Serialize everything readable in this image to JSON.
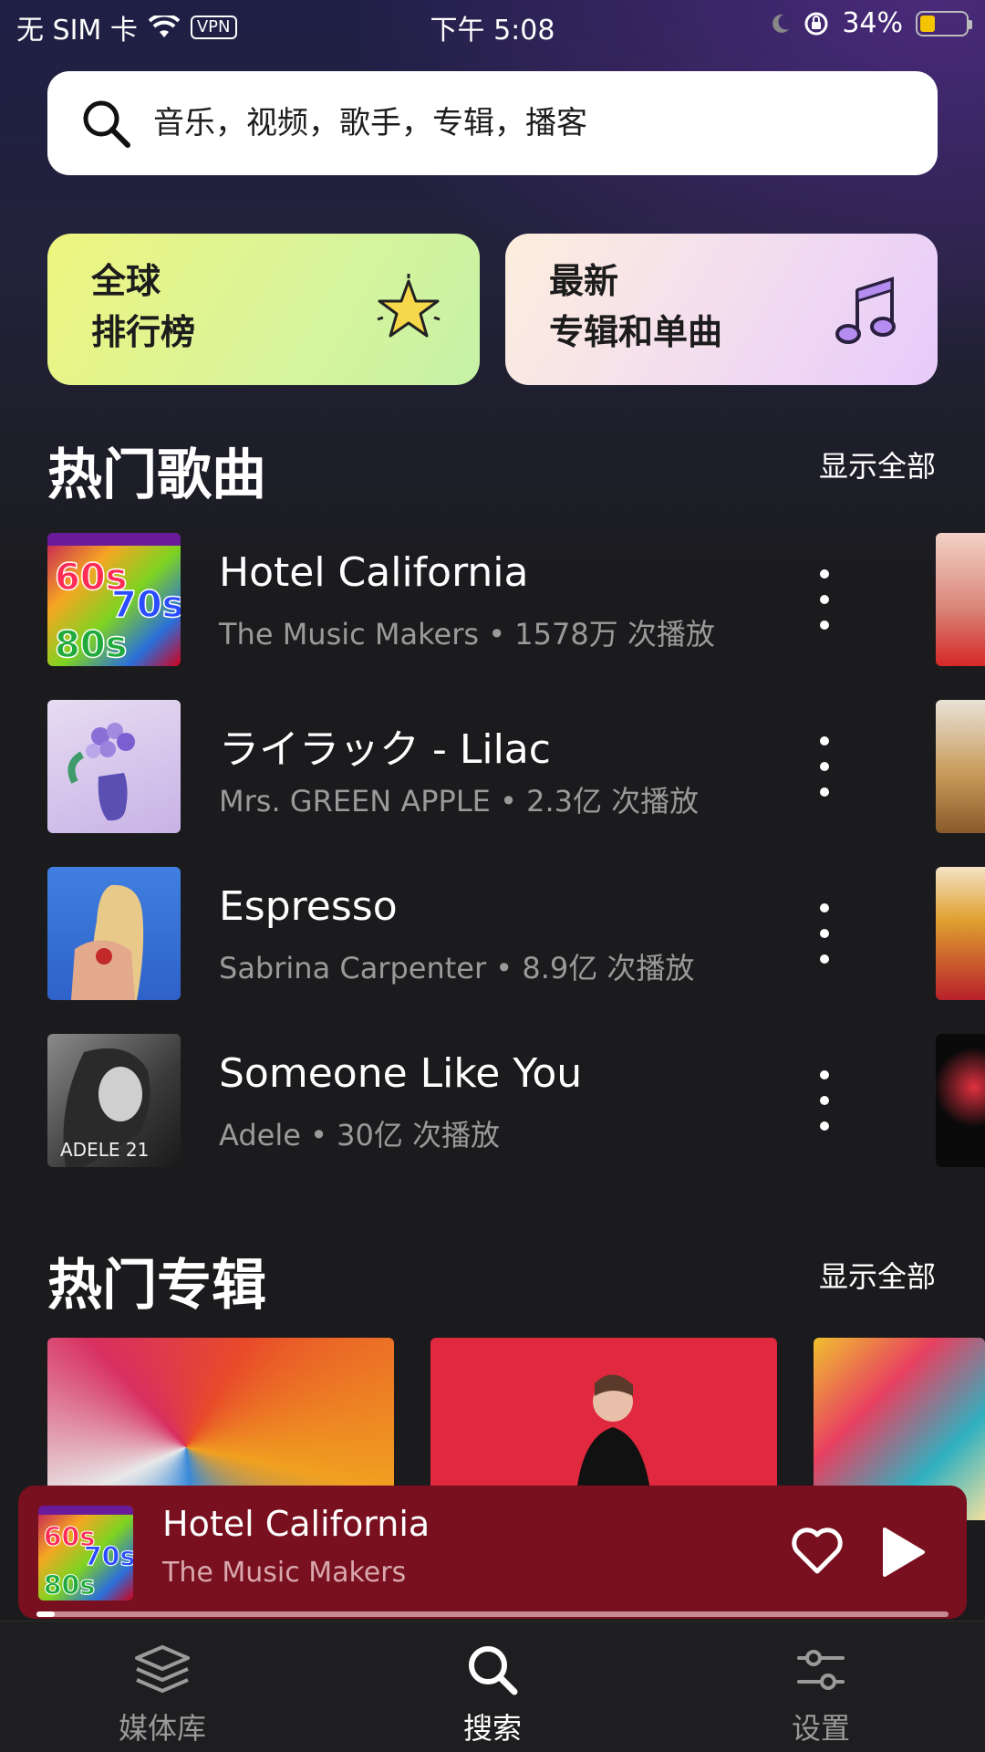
{
  "status_bar": {
    "carrier": "无 SIM 卡",
    "vpn": "VPN",
    "time": "下午 5:08",
    "battery": "34%",
    "battery_level": 0.34
  },
  "search": {
    "placeholder": "音乐，视频，歌手，专辑，播客"
  },
  "categories": [
    {
      "line1": "全球",
      "line2": "排行榜",
      "icon": "star-icon"
    },
    {
      "line1": "最新",
      "line2": "专辑和单曲",
      "icon": "music-note-icon"
    }
  ],
  "hot_songs": {
    "title": "热门歌曲",
    "show_all": "显示全部",
    "items": [
      {
        "title": "Hotel California",
        "artist": "The Music Makers",
        "sep": "•",
        "plays": "1578万 次播放"
      },
      {
        "title": "ライラック - Lilac",
        "artist": "Mrs. GREEN APPLE",
        "sep": "•",
        "plays": "2.3亿 次播放"
      },
      {
        "title": "Espresso",
        "artist": "Sabrina Carpenter",
        "sep": "•",
        "plays": "8.9亿 次播放"
      },
      {
        "title": "Someone Like You",
        "artist": "Adele",
        "sep": "•",
        "plays": "30亿 次播放"
      }
    ]
  },
  "hot_albums": {
    "title": "热门专辑",
    "show_all": "显示全部"
  },
  "now_playing": {
    "title": "Hotel California",
    "artist": "The Music Makers",
    "progress": 0.02
  },
  "tabs": [
    {
      "label": "媒体库",
      "icon": "layers-icon",
      "active": false
    },
    {
      "label": "搜索",
      "icon": "search-icon",
      "active": true
    },
    {
      "label": "设置",
      "icon": "sliders-icon",
      "active": false
    }
  ],
  "colors": {
    "accent": "#79101f",
    "background": "#1b1b1e"
  }
}
